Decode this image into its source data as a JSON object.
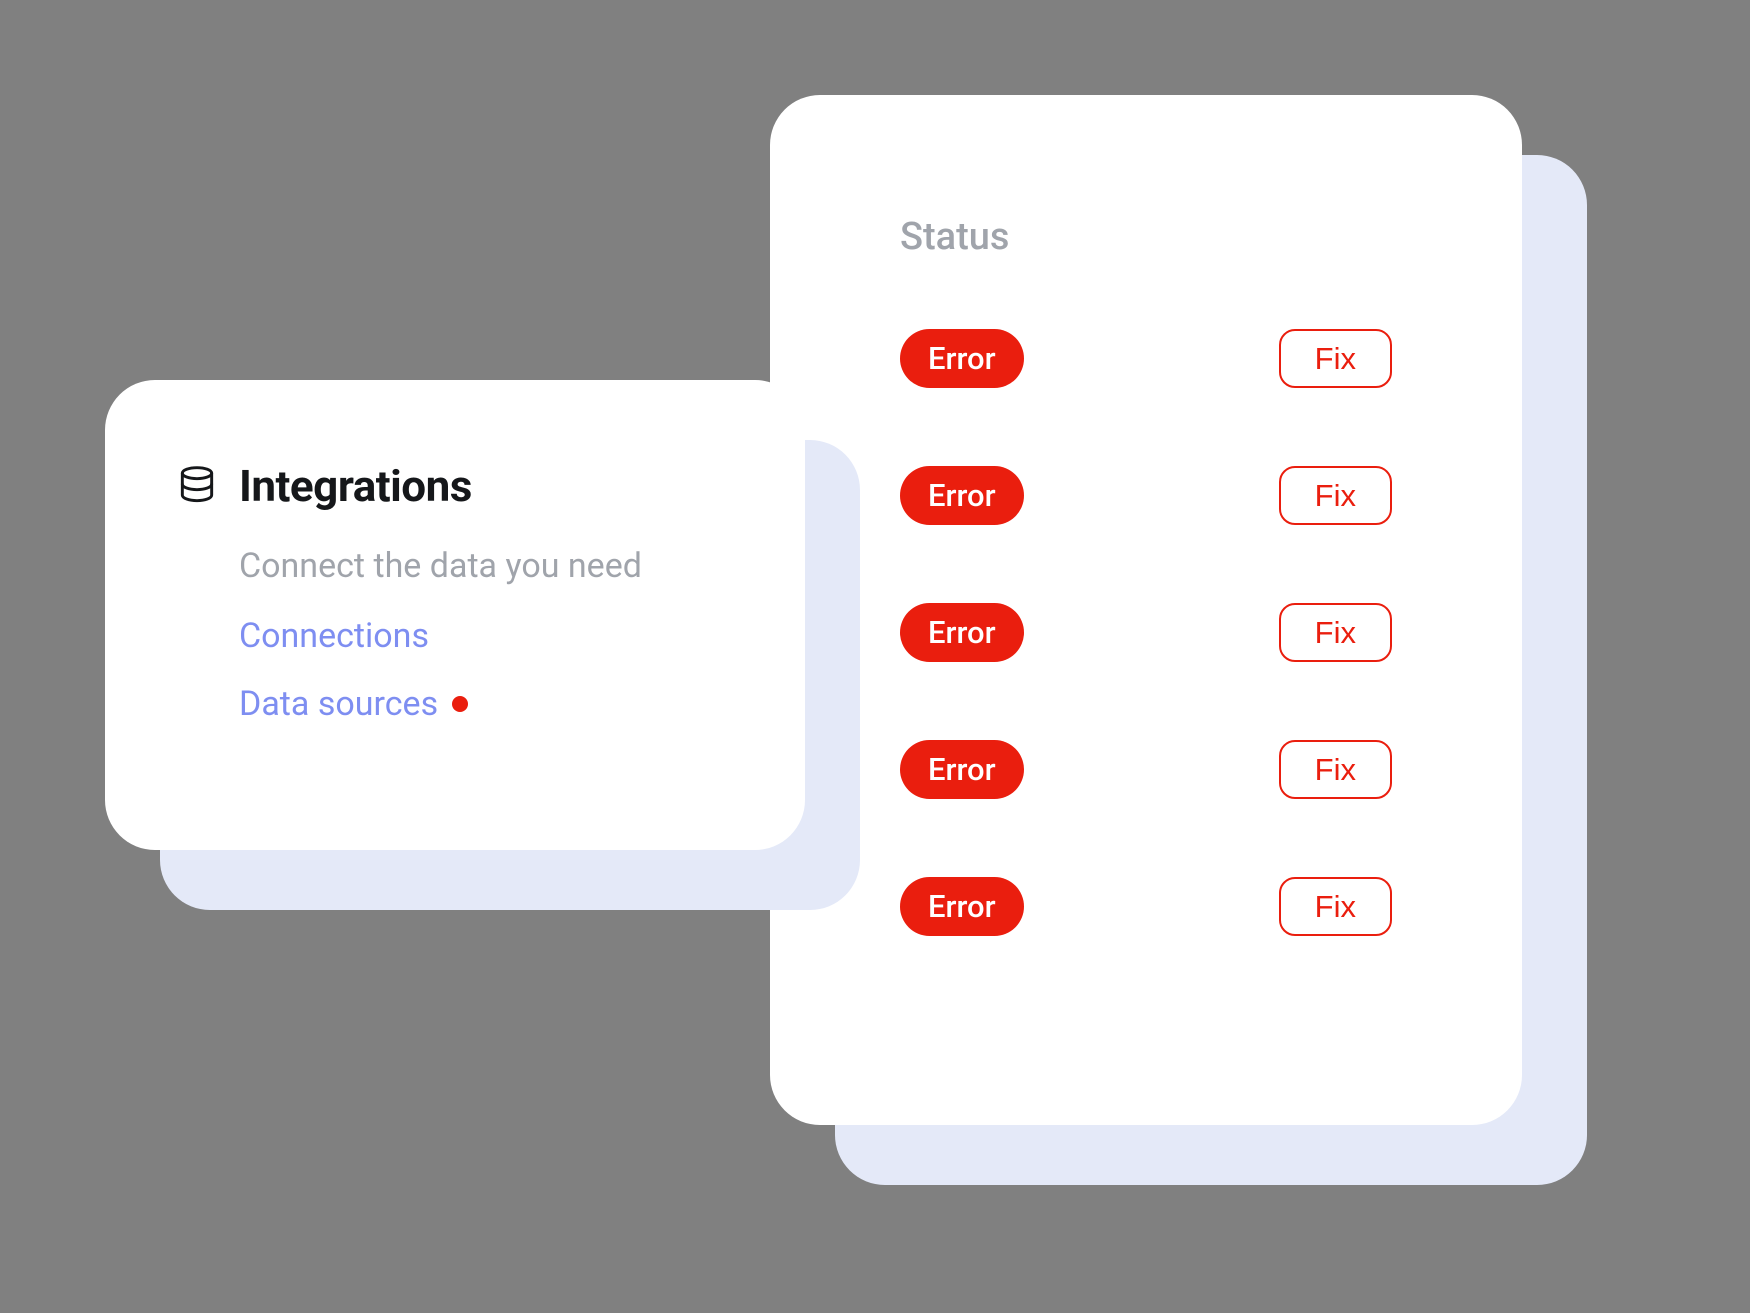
{
  "integrations": {
    "title": "Integrations",
    "subtitle": "Connect the data you need",
    "links": {
      "connections": "Connections",
      "data_sources": "Data sources"
    }
  },
  "status": {
    "heading": "Status",
    "rows": [
      {
        "badge": "Error",
        "action": "Fix"
      },
      {
        "badge": "Error",
        "action": "Fix"
      },
      {
        "badge": "Error",
        "action": "Fix"
      },
      {
        "badge": "Error",
        "action": "Fix"
      },
      {
        "badge": "Error",
        "action": "Fix"
      }
    ]
  },
  "colors": {
    "error": "#EA1E0E",
    "link": "#7E8EF1",
    "muted": "#A0A4AB",
    "shadow": "#E4E9F8"
  }
}
